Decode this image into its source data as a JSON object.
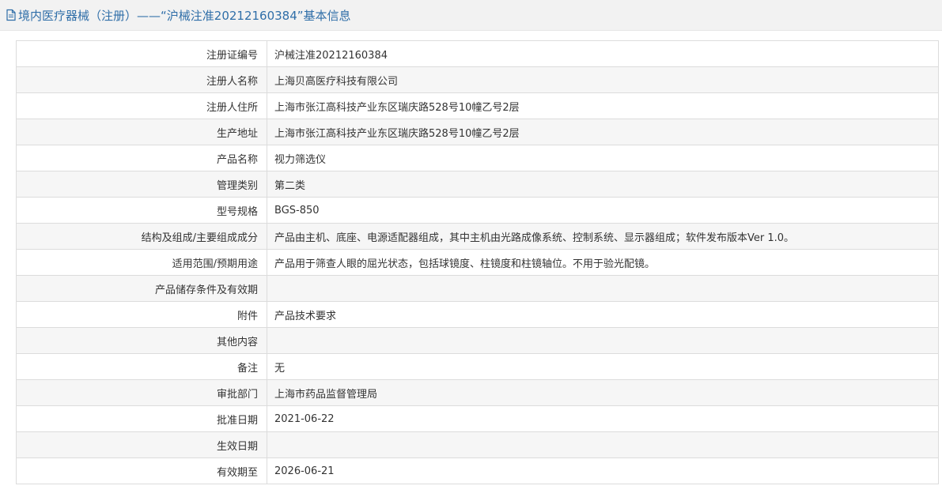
{
  "header": {
    "icon": "document-icon",
    "title": "境内医疗器械（注册）——“沪械注准20212160384”基本信息",
    "title_color": "#2f6ea8"
  },
  "rows": [
    {
      "label": "注册证编号",
      "value": "沪械注准20212160384"
    },
    {
      "label": "注册人名称",
      "value": "上海贝高医疗科技有限公司"
    },
    {
      "label": "注册人住所",
      "value": "上海市张江高科技产业东区瑞庆路528号10幢乙号2层"
    },
    {
      "label": "生产地址",
      "value": "上海市张江高科技产业东区瑞庆路528号10幢乙号2层"
    },
    {
      "label": "产品名称",
      "value": "视力筛选仪"
    },
    {
      "label": "管理类别",
      "value": "第二类"
    },
    {
      "label": "型号规格",
      "value": "BGS-850"
    },
    {
      "label": "结构及组成/主要组成成分",
      "value": "产品由主机、底座、电源适配器组成，其中主机由光路成像系统、控制系统、显示器组成；软件发布版本Ver 1.0。"
    },
    {
      "label": "适用范围/预期用途",
      "value": "产品用于筛查人眼的屈光状态，包括球镜度、柱镜度和柱镜轴位。不用于验光配镜。"
    },
    {
      "label": "产品储存条件及有效期",
      "value": ""
    },
    {
      "label": "附件",
      "value": "产品技术要求"
    },
    {
      "label": "其他内容",
      "value": ""
    },
    {
      "label": "备注",
      "value": "无"
    },
    {
      "label": "审批部门",
      "value": "上海市药品监督管理局"
    },
    {
      "label": "批准日期",
      "value": "2021-06-22"
    },
    {
      "label": "生效日期",
      "value": ""
    },
    {
      "label": "有效期至",
      "value": "2026-06-21"
    }
  ]
}
